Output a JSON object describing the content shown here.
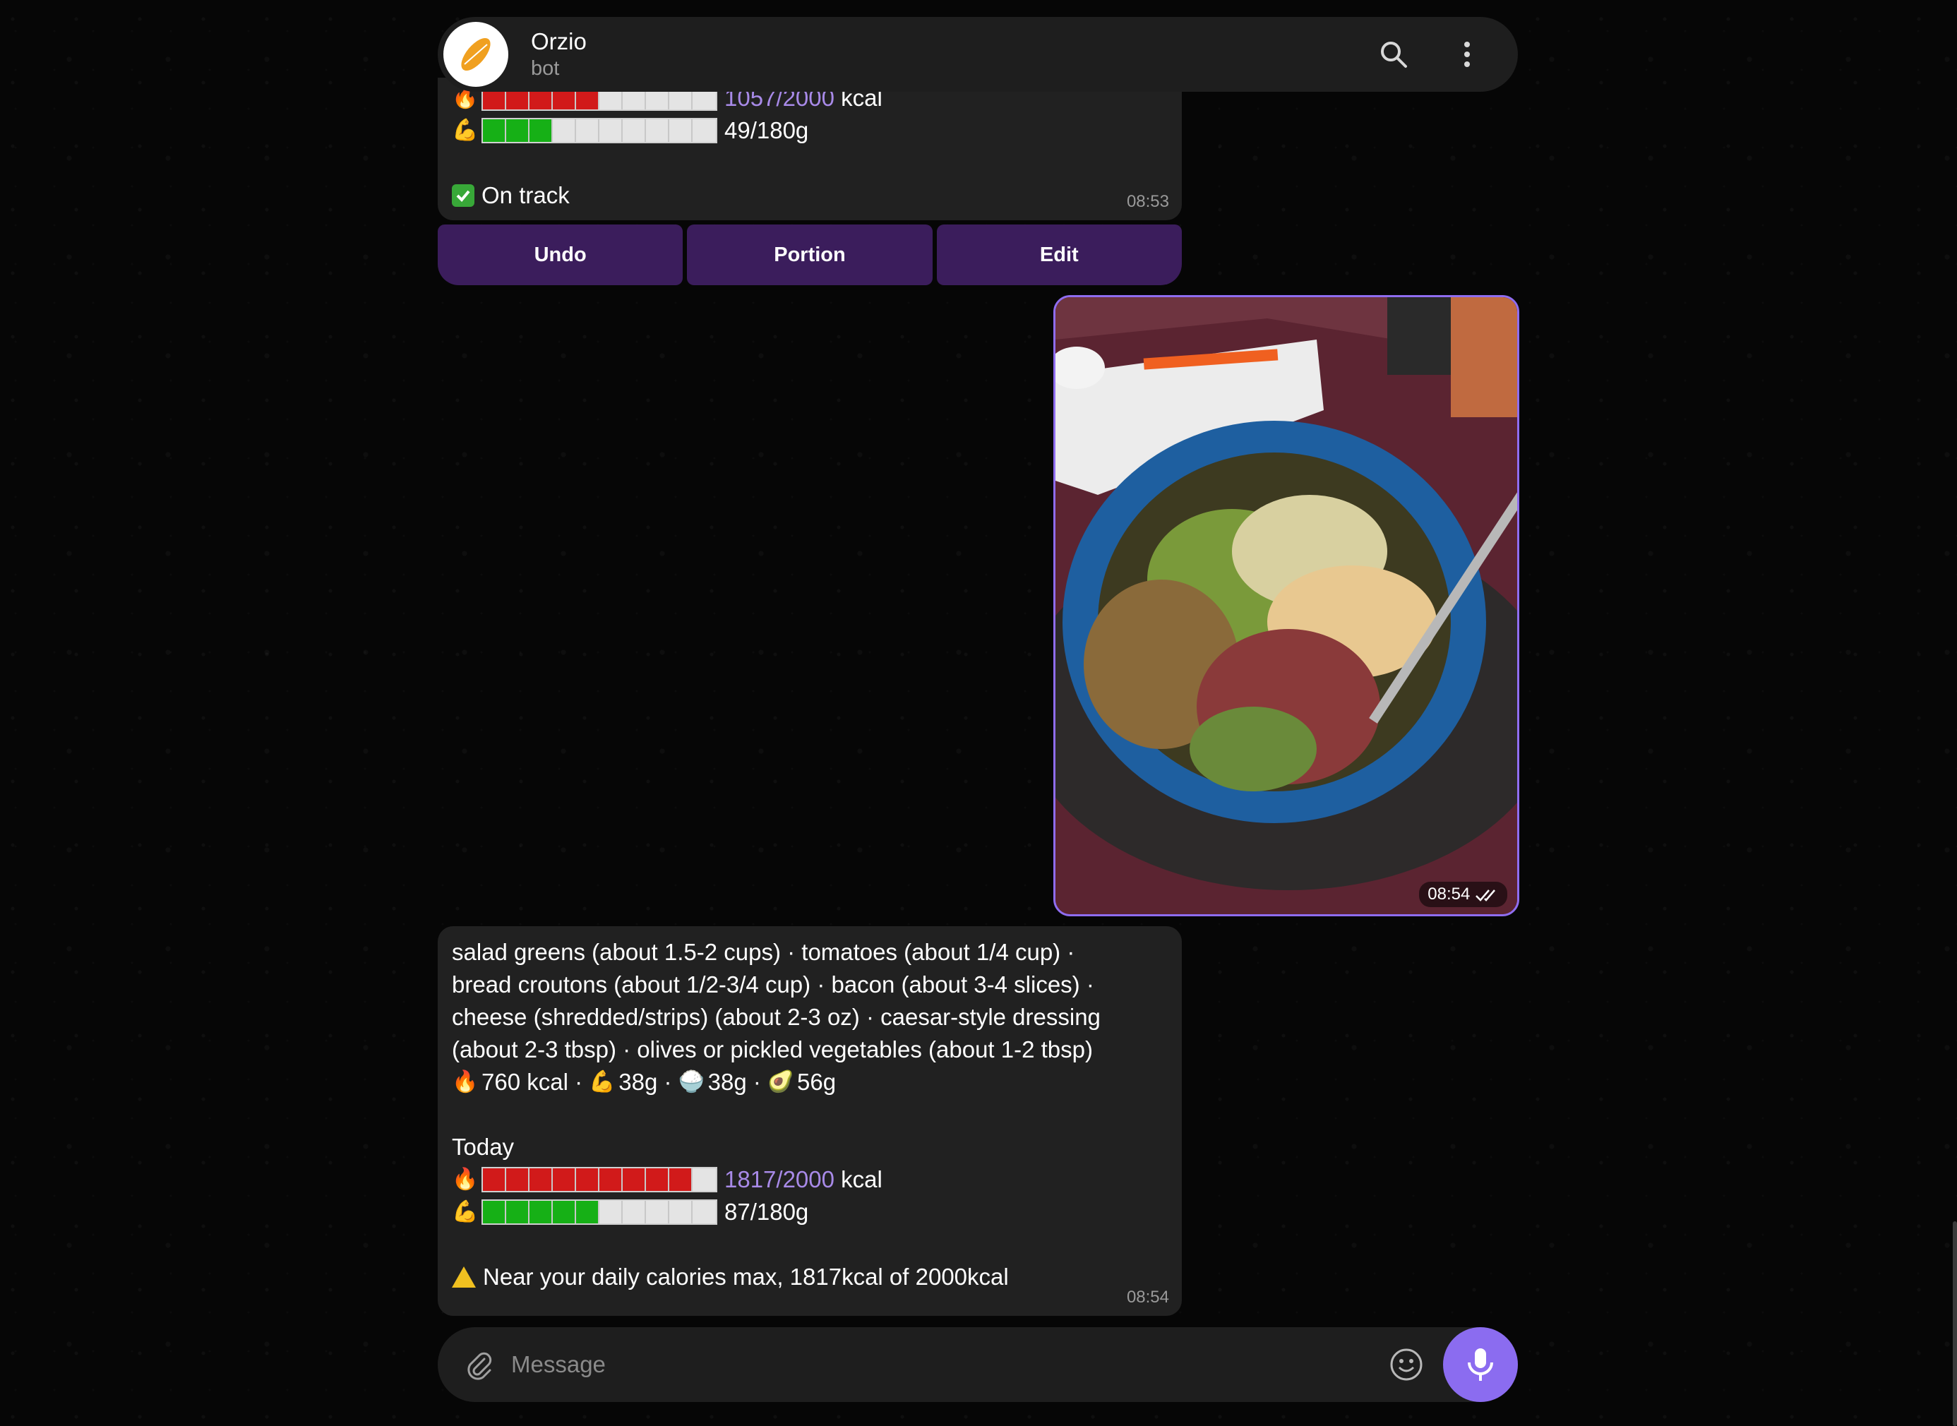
{
  "header": {
    "title": "Orzio",
    "subtitle": "bot",
    "icons": {
      "search": "search-icon",
      "menu": "more-vertical-icon"
    }
  },
  "message1": {
    "kcal_value": "1057/2000",
    "kcal_unit": "kcal",
    "kcal_progress": 0.5,
    "protein_value": "49/180g",
    "protein_progress": 0.3,
    "status": "On track",
    "time": "08:53"
  },
  "keyboard": {
    "undo": "Undo",
    "portion": "Portion",
    "edit": "Edit"
  },
  "photo": {
    "time": "08:54",
    "description_icon": "salad-photo"
  },
  "message2": {
    "line1": "salad greens (about 1.5-2 cups) · tomatoes (about 1/4 cup) ·",
    "line2": "bread croutons (about 1/2-3/4 cup) · bacon (about 3-4 slices) ·",
    "line3": "cheese (shredded/strips) (about 2-3 oz) · caesar-style dressing",
    "line4": "(about 2-3 tbsp) · olives or pickled vegetables (about 1-2 tbsp)",
    "kcal": "760 kcal",
    "protein": "38g",
    "carbs": "38g",
    "fat": "56g",
    "today_label": "Today",
    "kcal_value": "1817/2000",
    "kcal_unit": "kcal",
    "kcal_progress": 0.9,
    "protein_value": "87/180g",
    "protein_progress": 0.5,
    "warning": "Near your daily calories max, 1817kcal of 2000kcal",
    "time": "08:54"
  },
  "composer": {
    "placeholder": "Message"
  },
  "colors": {
    "accent": "#8b6cf0",
    "bubble": "#212121",
    "keyboard_button": "#3b1d5c",
    "bar_red": "#d11a1a",
    "bar_green": "#16b016",
    "link": "#a88ae8"
  }
}
